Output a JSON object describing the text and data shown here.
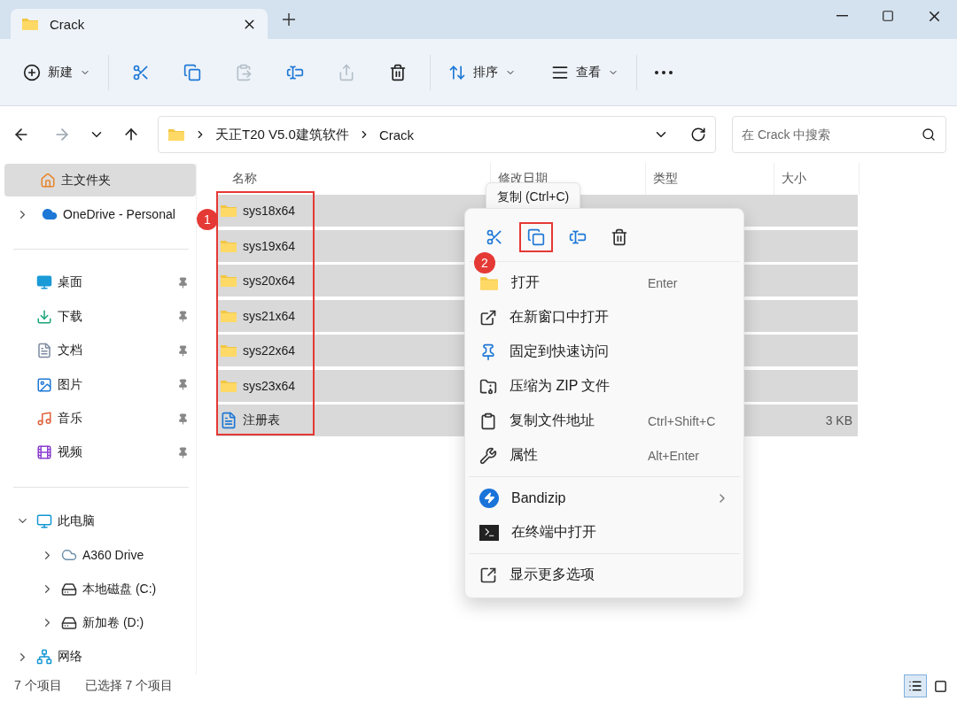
{
  "tab": {
    "title": "Crack"
  },
  "toolbar": {
    "new_label": "新建",
    "sort_label": "排序",
    "view_label": "查看"
  },
  "address": {
    "path": [
      "天正T20 V5.0建筑软件",
      "Crack"
    ]
  },
  "search": {
    "placeholder": "在 Crack 中搜索"
  },
  "sidebar": {
    "top": [
      {
        "label": "主文件夹",
        "kind": "home",
        "selected": true
      },
      {
        "label": "OneDrive - Personal",
        "kind": "cloud",
        "selected": false
      }
    ],
    "pinned": [
      {
        "label": "桌面",
        "kind": "desktop",
        "selected": false
      },
      {
        "label": "下载",
        "kind": "download",
        "selected": false
      },
      {
        "label": "文档",
        "kind": "document",
        "selected": false
      },
      {
        "label": "图片",
        "kind": "picture",
        "selected": false
      },
      {
        "label": "音乐",
        "kind": "music",
        "selected": false
      },
      {
        "label": "视频",
        "kind": "video",
        "selected": false
      }
    ],
    "tree": [
      {
        "label": "此电脑",
        "kind": "pc",
        "expanded": true,
        "children": [
          {
            "label": "A360 Drive",
            "kind": "a360",
            "expanded": false
          },
          {
            "label": "本地磁盘 (C:)",
            "kind": "systemdrive",
            "expanded": false
          },
          {
            "label": "新加卷 (D:)",
            "kind": "drive",
            "expanded": false
          }
        ]
      },
      {
        "label": "网络",
        "kind": "network",
        "expanded": false
      }
    ]
  },
  "columns": [
    "名称",
    "修改日期",
    "类型",
    "大小"
  ],
  "files": [
    {
      "name": "sys18x64",
      "kind": "folder",
      "selected": true
    },
    {
      "name": "sys19x64",
      "kind": "folder",
      "selected": true
    },
    {
      "name": "sys20x64",
      "kind": "folder",
      "selected": true
    },
    {
      "name": "sys21x64",
      "kind": "folder",
      "selected": true
    },
    {
      "name": "sys22x64",
      "kind": "folder",
      "selected": true
    },
    {
      "name": "sys23x64",
      "kind": "folder",
      "selected": true
    },
    {
      "name": "注册表",
      "kind": "registry",
      "selected": true,
      "size": "3 KB"
    }
  ],
  "files_badge": "1",
  "context_menu": {
    "tooltip": "复制 (Ctrl+C)",
    "badge": "2",
    "quick_actions": [
      {
        "kind": "cut",
        "highlighted": false
      },
      {
        "kind": "copy",
        "highlighted": true
      },
      {
        "kind": "rename",
        "highlighted": false
      },
      {
        "kind": "delete",
        "highlighted": false
      }
    ],
    "groups": [
      [
        {
          "label": "打开",
          "kind": "open",
          "shortcut": "Enter"
        },
        {
          "label": "在新窗口中打开",
          "kind": "newwindow"
        },
        {
          "label": "固定到快速访问",
          "kind": "pin"
        },
        {
          "label": "压缩为 ZIP 文件",
          "kind": "zip"
        },
        {
          "label": "复制文件地址",
          "kind": "path",
          "shortcut": "Ctrl+Shift+C"
        },
        {
          "label": "属性",
          "kind": "properties",
          "shortcut": "Alt+Enter"
        }
      ],
      [
        {
          "label": "Bandizip",
          "kind": "bandizip",
          "submenu": true
        },
        {
          "label": "在终端中打开",
          "kind": "terminal"
        }
      ],
      [
        {
          "label": "显示更多选项",
          "kind": "more"
        }
      ]
    ]
  },
  "status_bar": {
    "count": "7 个项目",
    "selection": "已选择 7 个项目",
    "views": [
      {
        "kind": "details",
        "selected": true
      },
      {
        "kind": "tiles",
        "selected": false
      }
    ]
  }
}
